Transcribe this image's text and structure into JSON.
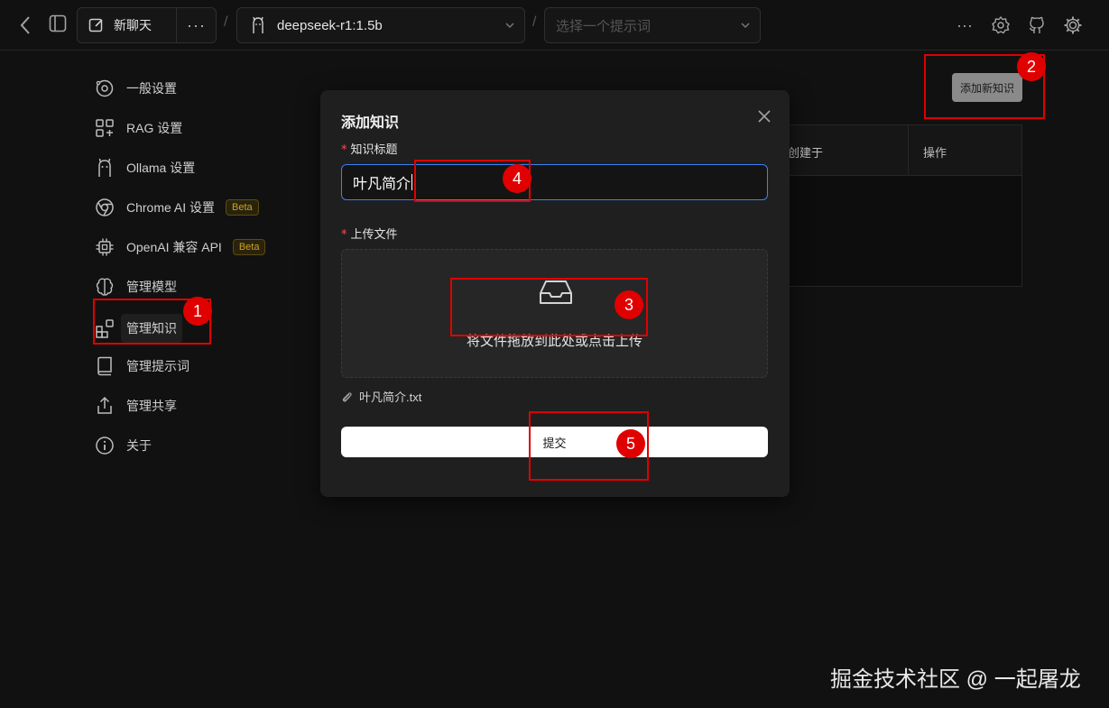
{
  "topbar": {
    "new_chat_label": "新聊天",
    "model_name": "deepseek-r1:1.5b",
    "prompt_placeholder": "选择一个提示词"
  },
  "sidebar": {
    "items": [
      {
        "label": "一般设置",
        "icon": "general-settings-icon"
      },
      {
        "label": "RAG 设置",
        "icon": "rag-icon"
      },
      {
        "label": "Ollama 设置",
        "icon": "ollama-icon"
      },
      {
        "label": "Chrome AI 设置",
        "icon": "chrome-icon",
        "badge": "Beta"
      },
      {
        "label": "OpenAI 兼容 API",
        "icon": "chip-icon",
        "badge": "Beta"
      },
      {
        "label": "管理模型",
        "icon": "brain-icon"
      },
      {
        "label": "管理知识",
        "icon": "blocks-icon",
        "active": true
      },
      {
        "label": "管理提示词",
        "icon": "book-icon"
      },
      {
        "label": "管理共享",
        "icon": "share-icon"
      },
      {
        "label": "关于",
        "icon": "info-icon"
      }
    ]
  },
  "main": {
    "add_button": "添加新知识",
    "table_headers": [
      "创建于",
      "操作"
    ]
  },
  "modal": {
    "title": "添加知识",
    "title_field_label": "知识标题",
    "title_field_value": "叶凡简介",
    "upload_label": "上传文件",
    "dropzone_text": "将文件拖放到此处或点击上传",
    "file_name": "叶凡简介.txt",
    "submit_label": "提交"
  },
  "annotations": [
    "1",
    "2",
    "3",
    "4",
    "5"
  ],
  "watermark": "掘金技术社区 @ 一起屠龙",
  "colors": {
    "background": "#111111",
    "modal": "#1f1f1f",
    "annotation": "#e00000",
    "focus": "#3b82f6",
    "beta": "#c9a227"
  }
}
